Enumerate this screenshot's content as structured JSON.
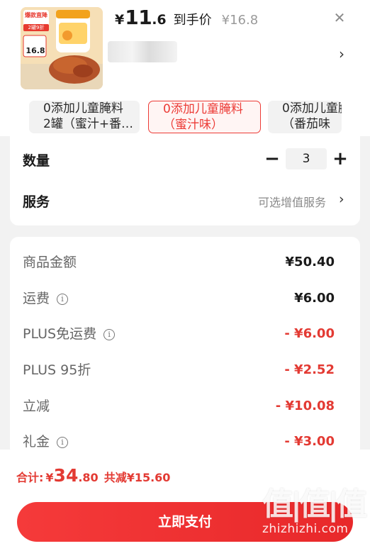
{
  "product": {
    "image_badge_top": "爆款直降",
    "image_badge_sub": "2罐9折",
    "image_price_tag": "16.8",
    "price_yen": "¥",
    "price_int": "11",
    "price_dec": ".6",
    "price_label": "到手价",
    "original_price": "¥16.8"
  },
  "specs": [
    {
      "line1": "0添加儿童腌料",
      "line2": "2罐（蜜汁+番…",
      "selected": false
    },
    {
      "line1": "0添加儿童腌料",
      "line2": "（蜜汁味）",
      "selected": true
    },
    {
      "line1": "0添加儿童腌料",
      "line2": "（番茄味",
      "selected": false
    }
  ],
  "quantity": {
    "label": "数量",
    "value": "3",
    "minus": "−",
    "plus": "+"
  },
  "service": {
    "label": "服务",
    "hint": "可选增值服务"
  },
  "pricing": [
    {
      "label": "商品金额",
      "info": false,
      "value": "¥50.40",
      "red": false
    },
    {
      "label": "运费",
      "info": true,
      "value": "¥6.00",
      "red": false
    },
    {
      "label": "PLUS免运费",
      "info": true,
      "value": "- ¥6.00",
      "red": true
    },
    {
      "label": "PLUS 95折",
      "info": false,
      "value": "- ¥2.52",
      "red": true
    },
    {
      "label": "立减",
      "info": false,
      "value": "- ¥10.08",
      "red": true
    },
    {
      "label": "礼金",
      "info": true,
      "value": "- ¥3.00",
      "red": true
    }
  ],
  "total": {
    "label": "合计:",
    "yen": "¥",
    "int": "34",
    "dec": ".80",
    "savings": "共减¥15.60"
  },
  "pay_button": "立即支付",
  "watermark": {
    "logo": "值|值|值",
    "url": "zhizhizhi.com"
  },
  "colors": {
    "accent": "#e33a33",
    "background": "#f2f2f2"
  }
}
